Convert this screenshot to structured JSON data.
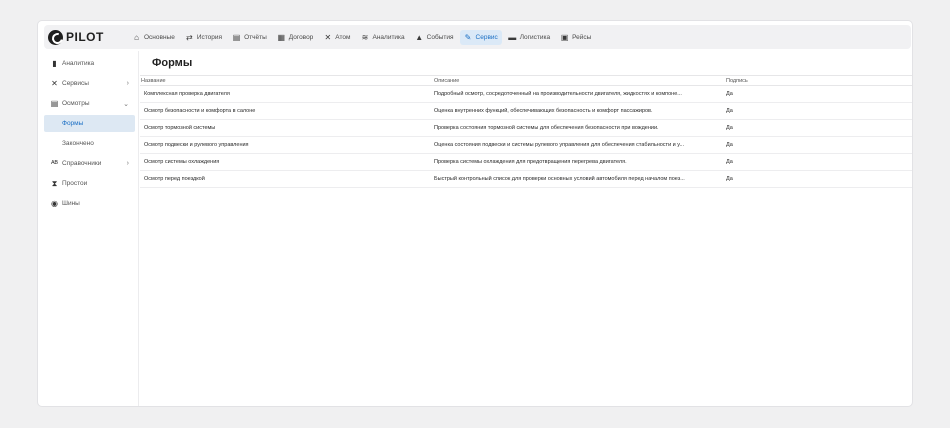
{
  "app": {
    "logo_text": "PILOT"
  },
  "nav": [
    {
      "label": "Основные",
      "icon": "home-icon",
      "glyph": "⌂",
      "active": false
    },
    {
      "label": "История",
      "icon": "history-icon",
      "glyph": "⇄",
      "active": false
    },
    {
      "label": "Отчёты",
      "icon": "report-icon",
      "glyph": "▤",
      "active": false
    },
    {
      "label": "Договор",
      "icon": "contract-icon",
      "glyph": "▦",
      "active": false
    },
    {
      "label": "Атом",
      "icon": "atom-icon",
      "glyph": "✕",
      "active": false
    },
    {
      "label": "Аналитика",
      "icon": "analytics-icon",
      "glyph": "≋",
      "active": false
    },
    {
      "label": "События",
      "icon": "bell-icon",
      "glyph": "▲",
      "active": false
    },
    {
      "label": "Сервис",
      "icon": "wrench-icon",
      "glyph": "✎",
      "active": true
    },
    {
      "label": "Логистика",
      "icon": "truck-icon",
      "glyph": "▬",
      "active": false
    },
    {
      "label": "Рейсы",
      "icon": "bus-icon",
      "glyph": "▣",
      "active": false
    }
  ],
  "sidebar": {
    "items": [
      {
        "label": "Аналитика",
        "icon": "bar-chart-icon",
        "glyph": "▮"
      },
      {
        "label": "Сервисы",
        "icon": "tools-icon",
        "glyph": "✕",
        "chevron": "›"
      },
      {
        "label": "Осмотры",
        "icon": "document-icon",
        "glyph": "▤",
        "chevron": "⌄"
      }
    ],
    "sub_items": [
      {
        "label": "Формы",
        "active": true
      },
      {
        "label": "Закончено",
        "active": false
      }
    ],
    "items_after": [
      {
        "label": "Справочники",
        "icon": "abc-icon",
        "glyph": "ᴬᴮ",
        "chevron": "›"
      },
      {
        "label": "Простои",
        "icon": "hourglass-icon",
        "glyph": "⧗"
      },
      {
        "label": "Шины",
        "icon": "tire-icon",
        "glyph": "◉"
      }
    ]
  },
  "main": {
    "title": "Формы",
    "columns": [
      "Название",
      "Описание",
      "Подпись"
    ],
    "rows": [
      [
        "Комплексная проверка двигателя",
        "Подробный осмотр, сосредоточенный на производительности двигателя, жидкостях и компоне...",
        "Да"
      ],
      [
        "Осмотр безопасности и комфорта в салоне",
        "Оценка внутренних функций, обеспечивающих безопасность и комфорт пассажиров.",
        "Да"
      ],
      [
        "Осмотр тормозной системы",
        "Проверка состояния тормозной системы для обеспечения безопасности при вождении.",
        "Да"
      ],
      [
        "Осмотр подвески и рулевого управления",
        "Оценка состояния подвески и системы рулевого управления для обеспечения стабильности и у...",
        "Да"
      ],
      [
        "Осмотр системы охлаждения",
        "Проверка системы охлаждения для предотвращения перегрева двигателя.",
        "Да"
      ],
      [
        "Осмотр перед поездкой",
        "Быстрый контрольный список для проверки основных условий автомобиля перед началом поез...",
        "Да"
      ]
    ]
  },
  "colors": {
    "accent": "#1b6fc4",
    "active_bg": "#dbe9f7",
    "page_bg": "#f0f0f1"
  }
}
